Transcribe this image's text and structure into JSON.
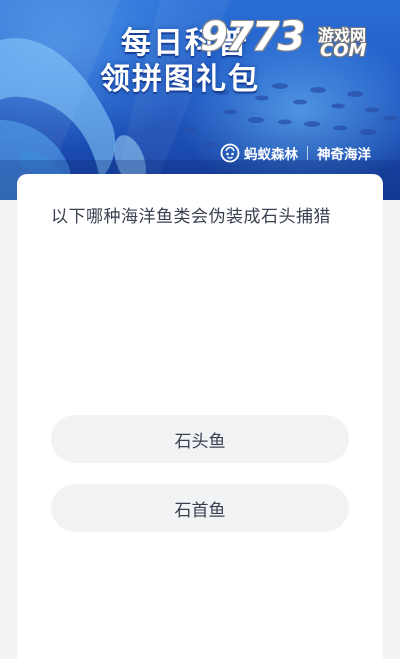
{
  "banner": {
    "title_line1": "每日科普",
    "title_line2": "领拼图礼包",
    "brand_name": "蚂蚁森林",
    "channel_name": "神奇海洋",
    "brand_icon": "ant-forest-logo-icon"
  },
  "watermark": {
    "number": "9773",
    "site_cn": "游戏网",
    "site_en": "COM"
  },
  "quiz": {
    "question": "以下哪种海洋鱼类会伪装成石头捕猎",
    "options": [
      {
        "label": "石头鱼"
      },
      {
        "label": "石首鱼"
      }
    ]
  },
  "colors": {
    "banner_blue": "#1f59c4",
    "card_bg": "#ffffff",
    "option_bg": "#f2f3f5",
    "text": "#3b4151",
    "page_bg": "#f2f3f5"
  }
}
